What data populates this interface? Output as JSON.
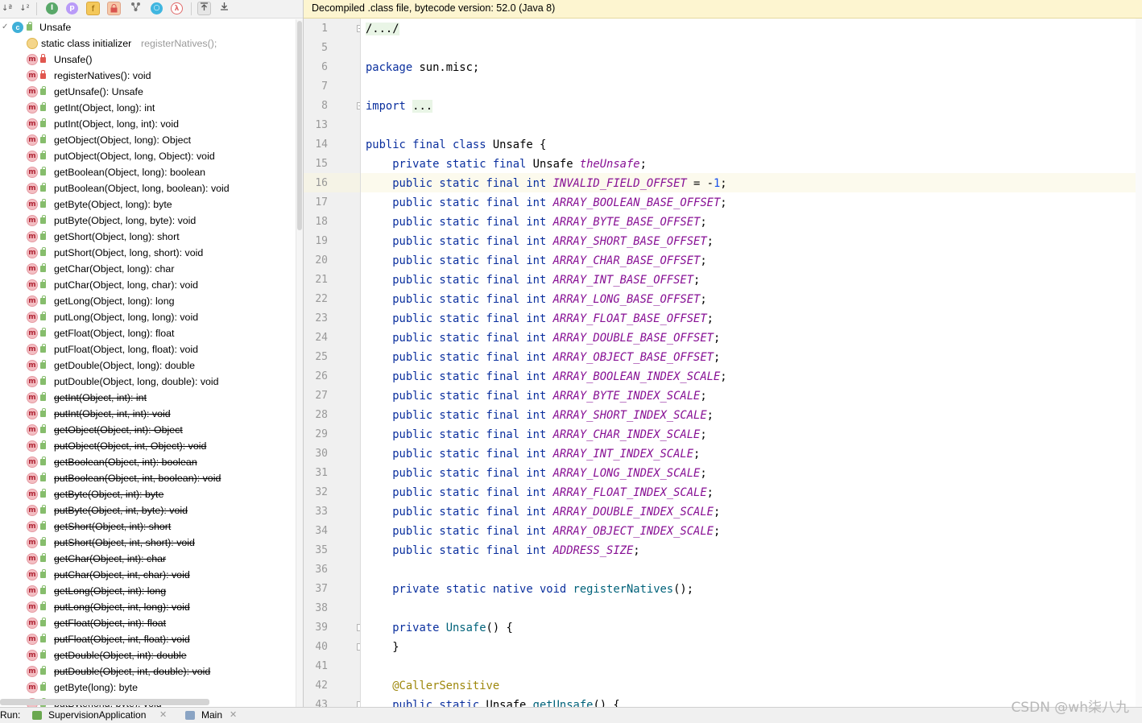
{
  "toolbar": {
    "sort_alpha_icon": "sort-alphabetically-icon",
    "sort_visibility_icon": "sort-by-visibility-icon",
    "show_inherited_label": "I",
    "show_properties_label": "p",
    "show_fields_label": "f",
    "show_nonpublic_icon": "lock-icon",
    "show_lambdas_label": "λ",
    "expand_icon": "expand-all-icon",
    "collapse_icon": "collapse-all-icon"
  },
  "structure": {
    "root_label": "Unsafe",
    "initializer_label": "static class initializer",
    "initializer_hint": "registerNatives();",
    "items": [
      {
        "label": "Unsafe()",
        "access": "private",
        "strike": false
      },
      {
        "label": "registerNatives(): void",
        "access": "private",
        "strike": false
      },
      {
        "label": "getUnsafe(): Unsafe",
        "access": "public",
        "strike": false
      },
      {
        "label": "getInt(Object, long): int",
        "access": "public",
        "strike": false
      },
      {
        "label": "putInt(Object, long, int): void",
        "access": "public",
        "strike": false
      },
      {
        "label": "getObject(Object, long): Object",
        "access": "public",
        "strike": false
      },
      {
        "label": "putObject(Object, long, Object): void",
        "access": "public",
        "strike": false
      },
      {
        "label": "getBoolean(Object, long): boolean",
        "access": "public",
        "strike": false
      },
      {
        "label": "putBoolean(Object, long, boolean): void",
        "access": "public",
        "strike": false
      },
      {
        "label": "getByte(Object, long): byte",
        "access": "public",
        "strike": false
      },
      {
        "label": "putByte(Object, long, byte): void",
        "access": "public",
        "strike": false
      },
      {
        "label": "getShort(Object, long): short",
        "access": "public",
        "strike": false
      },
      {
        "label": "putShort(Object, long, short): void",
        "access": "public",
        "strike": false
      },
      {
        "label": "getChar(Object, long): char",
        "access": "public",
        "strike": false
      },
      {
        "label": "putChar(Object, long, char): void",
        "access": "public",
        "strike": false
      },
      {
        "label": "getLong(Object, long): long",
        "access": "public",
        "strike": false
      },
      {
        "label": "putLong(Object, long, long): void",
        "access": "public",
        "strike": false
      },
      {
        "label": "getFloat(Object, long): float",
        "access": "public",
        "strike": false
      },
      {
        "label": "putFloat(Object, long, float): void",
        "access": "public",
        "strike": false
      },
      {
        "label": "getDouble(Object, long): double",
        "access": "public",
        "strike": false
      },
      {
        "label": "putDouble(Object, long, double): void",
        "access": "public",
        "strike": false
      },
      {
        "label": "getInt(Object, int): int",
        "access": "public",
        "strike": true
      },
      {
        "label": "putInt(Object, int, int): void",
        "access": "public",
        "strike": true
      },
      {
        "label": "getObject(Object, int): Object",
        "access": "public",
        "strike": true
      },
      {
        "label": "putObject(Object, int, Object): void",
        "access": "public",
        "strike": true
      },
      {
        "label": "getBoolean(Object, int): boolean",
        "access": "public",
        "strike": true
      },
      {
        "label": "putBoolean(Object, int, boolean): void",
        "access": "public",
        "strike": true
      },
      {
        "label": "getByte(Object, int): byte",
        "access": "public",
        "strike": true
      },
      {
        "label": "putByte(Object, int, byte): void",
        "access": "public",
        "strike": true
      },
      {
        "label": "getShort(Object, int): short",
        "access": "public",
        "strike": true
      },
      {
        "label": "putShort(Object, int, short): void",
        "access": "public",
        "strike": true
      },
      {
        "label": "getChar(Object, int): char",
        "access": "public",
        "strike": true
      },
      {
        "label": "putChar(Object, int, char): void",
        "access": "public",
        "strike": true
      },
      {
        "label": "getLong(Object, int): long",
        "access": "public",
        "strike": true
      },
      {
        "label": "putLong(Object, int, long): void",
        "access": "public",
        "strike": true
      },
      {
        "label": "getFloat(Object, int): float",
        "access": "public",
        "strike": true
      },
      {
        "label": "putFloat(Object, int, float): void",
        "access": "public",
        "strike": true
      },
      {
        "label": "getDouble(Object, int): double",
        "access": "public",
        "strike": true
      },
      {
        "label": "putDouble(Object, int, double): void",
        "access": "public",
        "strike": true
      },
      {
        "label": "getByte(long): byte",
        "access": "public",
        "strike": false
      },
      {
        "label": "putByte(long, byte): void",
        "access": "public",
        "strike": false
      }
    ]
  },
  "editor": {
    "banner": "Decompiled .class file, bytecode version: 52.0 (Java 8)",
    "current_line": "16",
    "lines": [
      {
        "n": "1",
        "tokens": [
          {
            "t": "/.../",
            "c": "fold-bg"
          }
        ],
        "fold": "+"
      },
      {
        "n": "5",
        "tokens": []
      },
      {
        "n": "6",
        "tokens": [
          {
            "t": "package",
            "c": "kw"
          },
          {
            "t": " sun.misc;",
            "c": ""
          }
        ]
      },
      {
        "n": "7",
        "tokens": []
      },
      {
        "n": "8",
        "tokens": [
          {
            "t": "import",
            "c": "kw"
          },
          {
            "t": " ",
            "c": ""
          },
          {
            "t": "...",
            "c": "fold-bg"
          }
        ],
        "fold": "+"
      },
      {
        "n": "13",
        "tokens": []
      },
      {
        "n": "14",
        "tokens": [
          {
            "t": "public final class",
            "c": "kw"
          },
          {
            "t": " Unsafe {",
            "c": ""
          }
        ]
      },
      {
        "n": "15",
        "tokens": [
          {
            "t": "    private static final",
            "c": "kw"
          },
          {
            "t": " Unsafe ",
            "c": ""
          },
          {
            "t": "theUnsafe",
            "c": "fld"
          },
          {
            "t": ";",
            "c": ""
          }
        ]
      },
      {
        "n": "16",
        "tokens": [
          {
            "t": "    public static final int",
            "c": "kw"
          },
          {
            "t": " ",
            "c": ""
          },
          {
            "t": "INVALID_FIELD_OFFSET",
            "c": "fld"
          },
          {
            "t": " = -",
            "c": ""
          },
          {
            "t": "1",
            "c": "num"
          },
          {
            "t": ";",
            "c": ""
          }
        ]
      },
      {
        "n": "17",
        "tokens": [
          {
            "t": "    public static final int",
            "c": "kw"
          },
          {
            "t": " ",
            "c": ""
          },
          {
            "t": "ARRAY_BOOLEAN_BASE_OFFSET",
            "c": "fld"
          },
          {
            "t": ";",
            "c": ""
          }
        ]
      },
      {
        "n": "18",
        "tokens": [
          {
            "t": "    public static final int",
            "c": "kw"
          },
          {
            "t": " ",
            "c": ""
          },
          {
            "t": "ARRAY_BYTE_BASE_OFFSET",
            "c": "fld"
          },
          {
            "t": ";",
            "c": ""
          }
        ]
      },
      {
        "n": "19",
        "tokens": [
          {
            "t": "    public static final int",
            "c": "kw"
          },
          {
            "t": " ",
            "c": ""
          },
          {
            "t": "ARRAY_SHORT_BASE_OFFSET",
            "c": "fld"
          },
          {
            "t": ";",
            "c": ""
          }
        ]
      },
      {
        "n": "20",
        "tokens": [
          {
            "t": "    public static final int",
            "c": "kw"
          },
          {
            "t": " ",
            "c": ""
          },
          {
            "t": "ARRAY_CHAR_BASE_OFFSET",
            "c": "fld"
          },
          {
            "t": ";",
            "c": ""
          }
        ]
      },
      {
        "n": "21",
        "tokens": [
          {
            "t": "    public static final int",
            "c": "kw"
          },
          {
            "t": " ",
            "c": ""
          },
          {
            "t": "ARRAY_INT_BASE_OFFSET",
            "c": "fld"
          },
          {
            "t": ";",
            "c": ""
          }
        ]
      },
      {
        "n": "22",
        "tokens": [
          {
            "t": "    public static final int",
            "c": "kw"
          },
          {
            "t": " ",
            "c": ""
          },
          {
            "t": "ARRAY_LONG_BASE_OFFSET",
            "c": "fld"
          },
          {
            "t": ";",
            "c": ""
          }
        ]
      },
      {
        "n": "23",
        "tokens": [
          {
            "t": "    public static final int",
            "c": "kw"
          },
          {
            "t": " ",
            "c": ""
          },
          {
            "t": "ARRAY_FLOAT_BASE_OFFSET",
            "c": "fld"
          },
          {
            "t": ";",
            "c": ""
          }
        ]
      },
      {
        "n": "24",
        "tokens": [
          {
            "t": "    public static final int",
            "c": "kw"
          },
          {
            "t": " ",
            "c": ""
          },
          {
            "t": "ARRAY_DOUBLE_BASE_OFFSET",
            "c": "fld"
          },
          {
            "t": ";",
            "c": ""
          }
        ]
      },
      {
        "n": "25",
        "tokens": [
          {
            "t": "    public static final int",
            "c": "kw"
          },
          {
            "t": " ",
            "c": ""
          },
          {
            "t": "ARRAY_OBJECT_BASE_OFFSET",
            "c": "fld"
          },
          {
            "t": ";",
            "c": ""
          }
        ]
      },
      {
        "n": "26",
        "tokens": [
          {
            "t": "    public static final int",
            "c": "kw"
          },
          {
            "t": " ",
            "c": ""
          },
          {
            "t": "ARRAY_BOOLEAN_INDEX_SCALE",
            "c": "fld"
          },
          {
            "t": ";",
            "c": ""
          }
        ]
      },
      {
        "n": "27",
        "tokens": [
          {
            "t": "    public static final int",
            "c": "kw"
          },
          {
            "t": " ",
            "c": ""
          },
          {
            "t": "ARRAY_BYTE_INDEX_SCALE",
            "c": "fld"
          },
          {
            "t": ";",
            "c": ""
          }
        ]
      },
      {
        "n": "28",
        "tokens": [
          {
            "t": "    public static final int",
            "c": "kw"
          },
          {
            "t": " ",
            "c": ""
          },
          {
            "t": "ARRAY_SHORT_INDEX_SCALE",
            "c": "fld"
          },
          {
            "t": ";",
            "c": ""
          }
        ]
      },
      {
        "n": "29",
        "tokens": [
          {
            "t": "    public static final int",
            "c": "kw"
          },
          {
            "t": " ",
            "c": ""
          },
          {
            "t": "ARRAY_CHAR_INDEX_SCALE",
            "c": "fld"
          },
          {
            "t": ";",
            "c": ""
          }
        ]
      },
      {
        "n": "30",
        "tokens": [
          {
            "t": "    public static final int",
            "c": "kw"
          },
          {
            "t": " ",
            "c": ""
          },
          {
            "t": "ARRAY_INT_INDEX_SCALE",
            "c": "fld"
          },
          {
            "t": ";",
            "c": ""
          }
        ]
      },
      {
        "n": "31",
        "tokens": [
          {
            "t": "    public static final int",
            "c": "kw"
          },
          {
            "t": " ",
            "c": ""
          },
          {
            "t": "ARRAY_LONG_INDEX_SCALE",
            "c": "fld"
          },
          {
            "t": ";",
            "c": ""
          }
        ]
      },
      {
        "n": "32",
        "tokens": [
          {
            "t": "    public static final int",
            "c": "kw"
          },
          {
            "t": " ",
            "c": ""
          },
          {
            "t": "ARRAY_FLOAT_INDEX_SCALE",
            "c": "fld"
          },
          {
            "t": ";",
            "c": ""
          }
        ]
      },
      {
        "n": "33",
        "tokens": [
          {
            "t": "    public static final int",
            "c": "kw"
          },
          {
            "t": " ",
            "c": ""
          },
          {
            "t": "ARRAY_DOUBLE_INDEX_SCALE",
            "c": "fld"
          },
          {
            "t": ";",
            "c": ""
          }
        ]
      },
      {
        "n": "34",
        "tokens": [
          {
            "t": "    public static final int",
            "c": "kw"
          },
          {
            "t": " ",
            "c": ""
          },
          {
            "t": "ARRAY_OBJECT_INDEX_SCALE",
            "c": "fld"
          },
          {
            "t": ";",
            "c": ""
          }
        ]
      },
      {
        "n": "35",
        "tokens": [
          {
            "t": "    public static final int",
            "c": "kw"
          },
          {
            "t": " ",
            "c": ""
          },
          {
            "t": "ADDRESS_SIZE",
            "c": "fld"
          },
          {
            "t": ";",
            "c": ""
          }
        ]
      },
      {
        "n": "36",
        "tokens": []
      },
      {
        "n": "37",
        "tokens": [
          {
            "t": "    private static native void",
            "c": "kw"
          },
          {
            "t": " ",
            "c": ""
          },
          {
            "t": "registerNatives",
            "c": "meth"
          },
          {
            "t": "();",
            "c": ""
          }
        ]
      },
      {
        "n": "38",
        "tokens": []
      },
      {
        "n": "39",
        "tokens": [
          {
            "t": "    private",
            "c": "kw"
          },
          {
            "t": " ",
            "c": ""
          },
          {
            "t": "Unsafe",
            "c": "meth"
          },
          {
            "t": "() {",
            "c": ""
          }
        ],
        "fold": "-"
      },
      {
        "n": "40",
        "tokens": [
          {
            "t": "    }",
            "c": ""
          }
        ],
        "fold": "-"
      },
      {
        "n": "41",
        "tokens": []
      },
      {
        "n": "42",
        "tokens": [
          {
            "t": "    @CallerSensitive",
            "c": "ann"
          }
        ]
      },
      {
        "n": "43",
        "tokens": [
          {
            "t": "    public static",
            "c": "kw"
          },
          {
            "t": " Unsafe ",
            "c": ""
          },
          {
            "t": "getUnsafe",
            "c": "meth"
          },
          {
            "t": "() {",
            "c": ""
          }
        ],
        "fold": "-"
      }
    ]
  },
  "bottom": {
    "run_label": "Run:",
    "tabs": [
      {
        "label": "SupervisionApplication",
        "icon": "spring-boot-icon"
      },
      {
        "label": "Main",
        "icon": "application-icon"
      }
    ],
    "watermark": "CSDN @wh柒八九"
  }
}
